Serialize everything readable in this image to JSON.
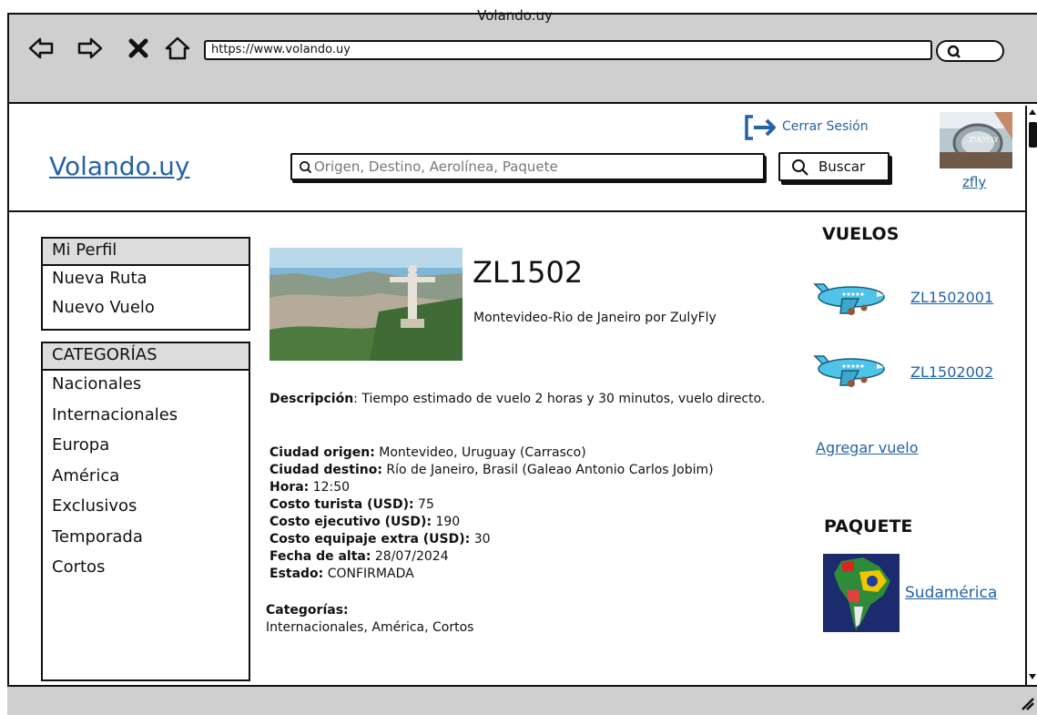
{
  "browser": {
    "window_title": "Volando.uy",
    "url": "https://www.volando.uy"
  },
  "header": {
    "logo": "Volando.uy",
    "search_placeholder": "Origen, Destino, Aerolínea, Paquete",
    "search_button": "Buscar",
    "logout": "Cerrar Sesión",
    "username": "zfly"
  },
  "sidebar": {
    "profile_menu": {
      "title": "Mi Perfil",
      "items": [
        "Nueva Ruta",
        "Nuevo Vuelo"
      ]
    },
    "categories_menu": {
      "title": "CATEGORÍAS",
      "items": [
        "Nacionales",
        "Internacionales",
        "Europa",
        "América",
        "Exclusivos",
        "Temporada",
        "Cortos"
      ]
    }
  },
  "route": {
    "code": "ZL1502",
    "subtitle": "Montevideo-Rio de Janeiro por ZulyFly",
    "description_label": "Descripción",
    "description": ": Tiempo estimado de vuelo 2 horas y 30 minutos, vuelo directo.",
    "fields": [
      {
        "label": "Ciudad origen:",
        "value": " Montevideo, Uruguay (Carrasco)"
      },
      {
        "label": "Ciudad destino:",
        "value": " Río de Janeiro, Brasil (Galeao Antonio Carlos Jobim)"
      },
      {
        "label": "Hora:",
        "value": " 12:50"
      },
      {
        "label": "Costo turista (USD):",
        "value": " 75"
      },
      {
        "label": "Costo ejecutivo (USD):",
        "value": " 190"
      },
      {
        "label": "Costo equipaje extra (USD):",
        "value": " 30"
      },
      {
        "label": "Fecha de alta:",
        "value": " 28/07/2024"
      },
      {
        "label": "Estado:",
        "value": " CONFIRMADA"
      }
    ],
    "categories_label": "Categorías:",
    "categories": "Internacionales, América, Cortos"
  },
  "flights": {
    "title": "VUELOS",
    "items": [
      "ZL1502001",
      "ZL1502002"
    ],
    "add_link": "Agregar vuelo"
  },
  "package": {
    "title": "PAQUETE",
    "name": "Sudamérica"
  },
  "avatar_text": "ZULYFLY",
  "colors": {
    "link": "#2463a6",
    "chrome": "#cfcfcf",
    "plane": "#4fc3e8"
  }
}
